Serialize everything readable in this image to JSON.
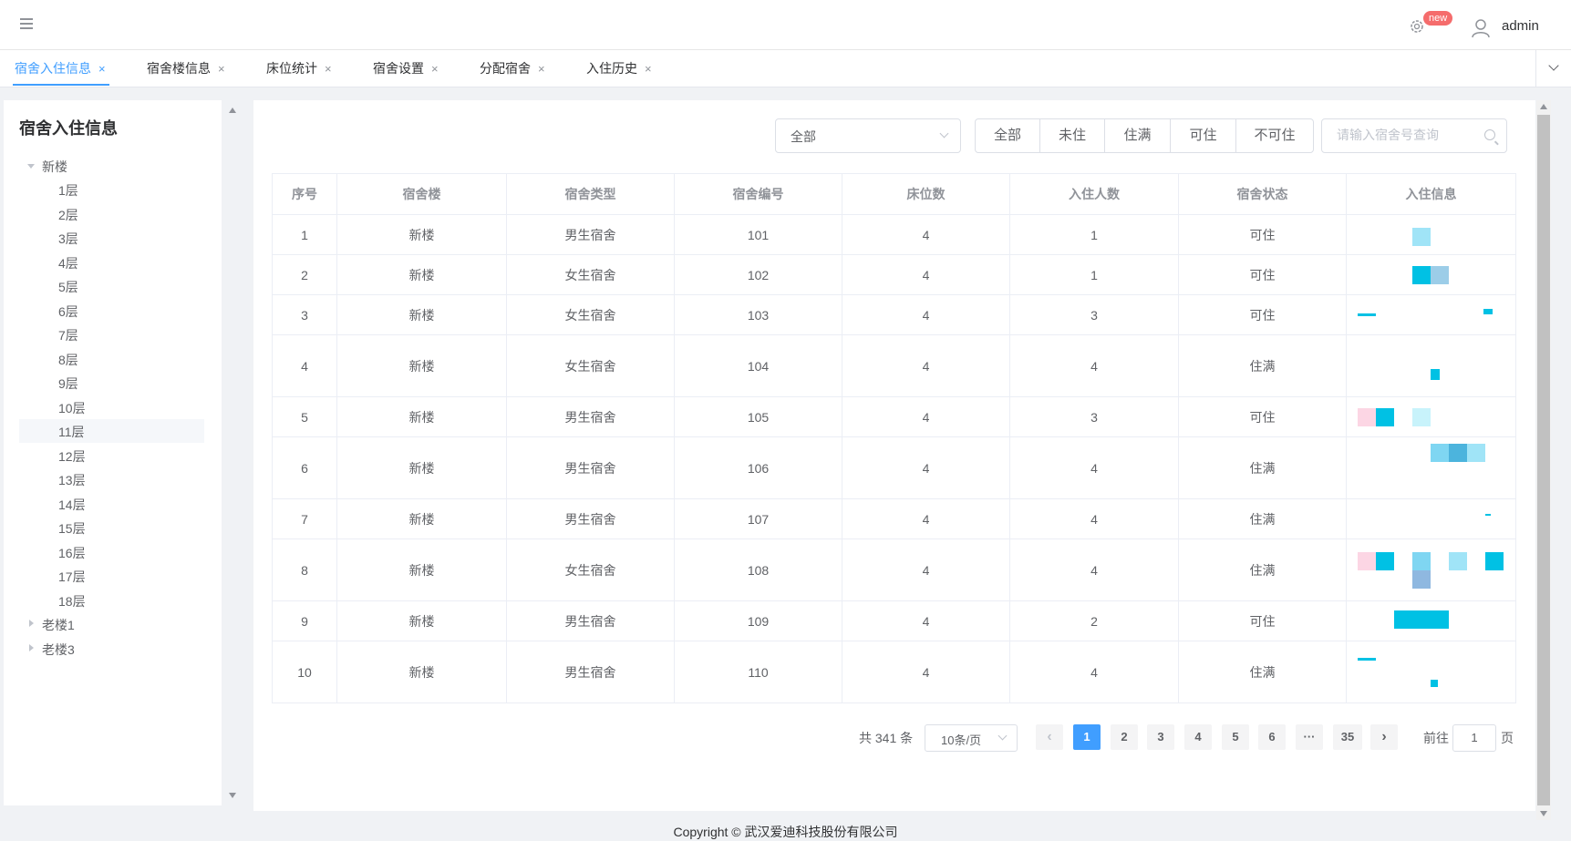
{
  "header": {
    "badge": "new",
    "user": "admin"
  },
  "tabs": [
    {
      "label": "宿舍入住信息",
      "close": "×"
    },
    {
      "label": "宿舍楼信息",
      "close": "×"
    },
    {
      "label": "床位统计",
      "close": "×"
    },
    {
      "label": "宿舍设置",
      "close": "×"
    },
    {
      "label": "分配宿舍",
      "close": "×"
    },
    {
      "label": "入住历史",
      "close": "×"
    }
  ],
  "sidebar": {
    "title": "宿舍入住信息",
    "tree": {
      "root": "新楼",
      "floors": [
        "1层",
        "2层",
        "3层",
        "4层",
        "5层",
        "6层",
        "7层",
        "8层",
        "9层",
        "10层",
        "11层",
        "12层",
        "13层",
        "14层",
        "15层",
        "16层",
        "17层",
        "18层"
      ],
      "others": [
        "老楼1",
        "老楼3"
      ]
    }
  },
  "filters": {
    "select_value": "全部",
    "status_buttons": [
      "全部",
      "未住",
      "住满",
      "可住",
      "不可住"
    ],
    "search_placeholder": "请输入宿舍号查询"
  },
  "table": {
    "columns": [
      "序号",
      "宿舍楼",
      "宿舍类型",
      "宿舍编号",
      "床位数",
      "入住人数",
      "宿舍状态",
      "入住信息"
    ],
    "rows": [
      [
        "1",
        "新楼",
        "男生宿舍",
        "101",
        "4",
        "1",
        "可住"
      ],
      [
        "2",
        "新楼",
        "女生宿舍",
        "102",
        "4",
        "1",
        "可住"
      ],
      [
        "3",
        "新楼",
        "女生宿舍",
        "103",
        "4",
        "3",
        "可住"
      ],
      [
        "4",
        "新楼",
        "女生宿舍",
        "104",
        "4",
        "4",
        "住满"
      ],
      [
        "5",
        "新楼",
        "男生宿舍",
        "105",
        "4",
        "3",
        "可住"
      ],
      [
        "6",
        "新楼",
        "男生宿舍",
        "106",
        "4",
        "4",
        "住满"
      ],
      [
        "7",
        "新楼",
        "男生宿舍",
        "107",
        "4",
        "4",
        "住满"
      ],
      [
        "8",
        "新楼",
        "女生宿舍",
        "108",
        "4",
        "4",
        "住满"
      ],
      [
        "9",
        "新楼",
        "男生宿舍",
        "109",
        "4",
        "2",
        "可住"
      ],
      [
        "10",
        "新楼",
        "男生宿舍",
        "110",
        "4",
        "4",
        "住满"
      ]
    ]
  },
  "pagination": {
    "total": "共 341 条",
    "page_size": "10条/页",
    "prev": "‹",
    "pages": [
      "1",
      "2",
      "3",
      "4",
      "5",
      "6",
      "···",
      "35"
    ],
    "next": "›",
    "goto_label": "前往",
    "goto_value": "1",
    "page_suffix": "页"
  },
  "footer": "Copyright © 武汉爱迪科技股份有限公司",
  "colors": {
    "accent": "#409eff",
    "badge": "#f56c6c",
    "info_cyan": "#00c1e4",
    "info_light": "#a0e4f7",
    "info_pink": "#fcd6e4"
  }
}
